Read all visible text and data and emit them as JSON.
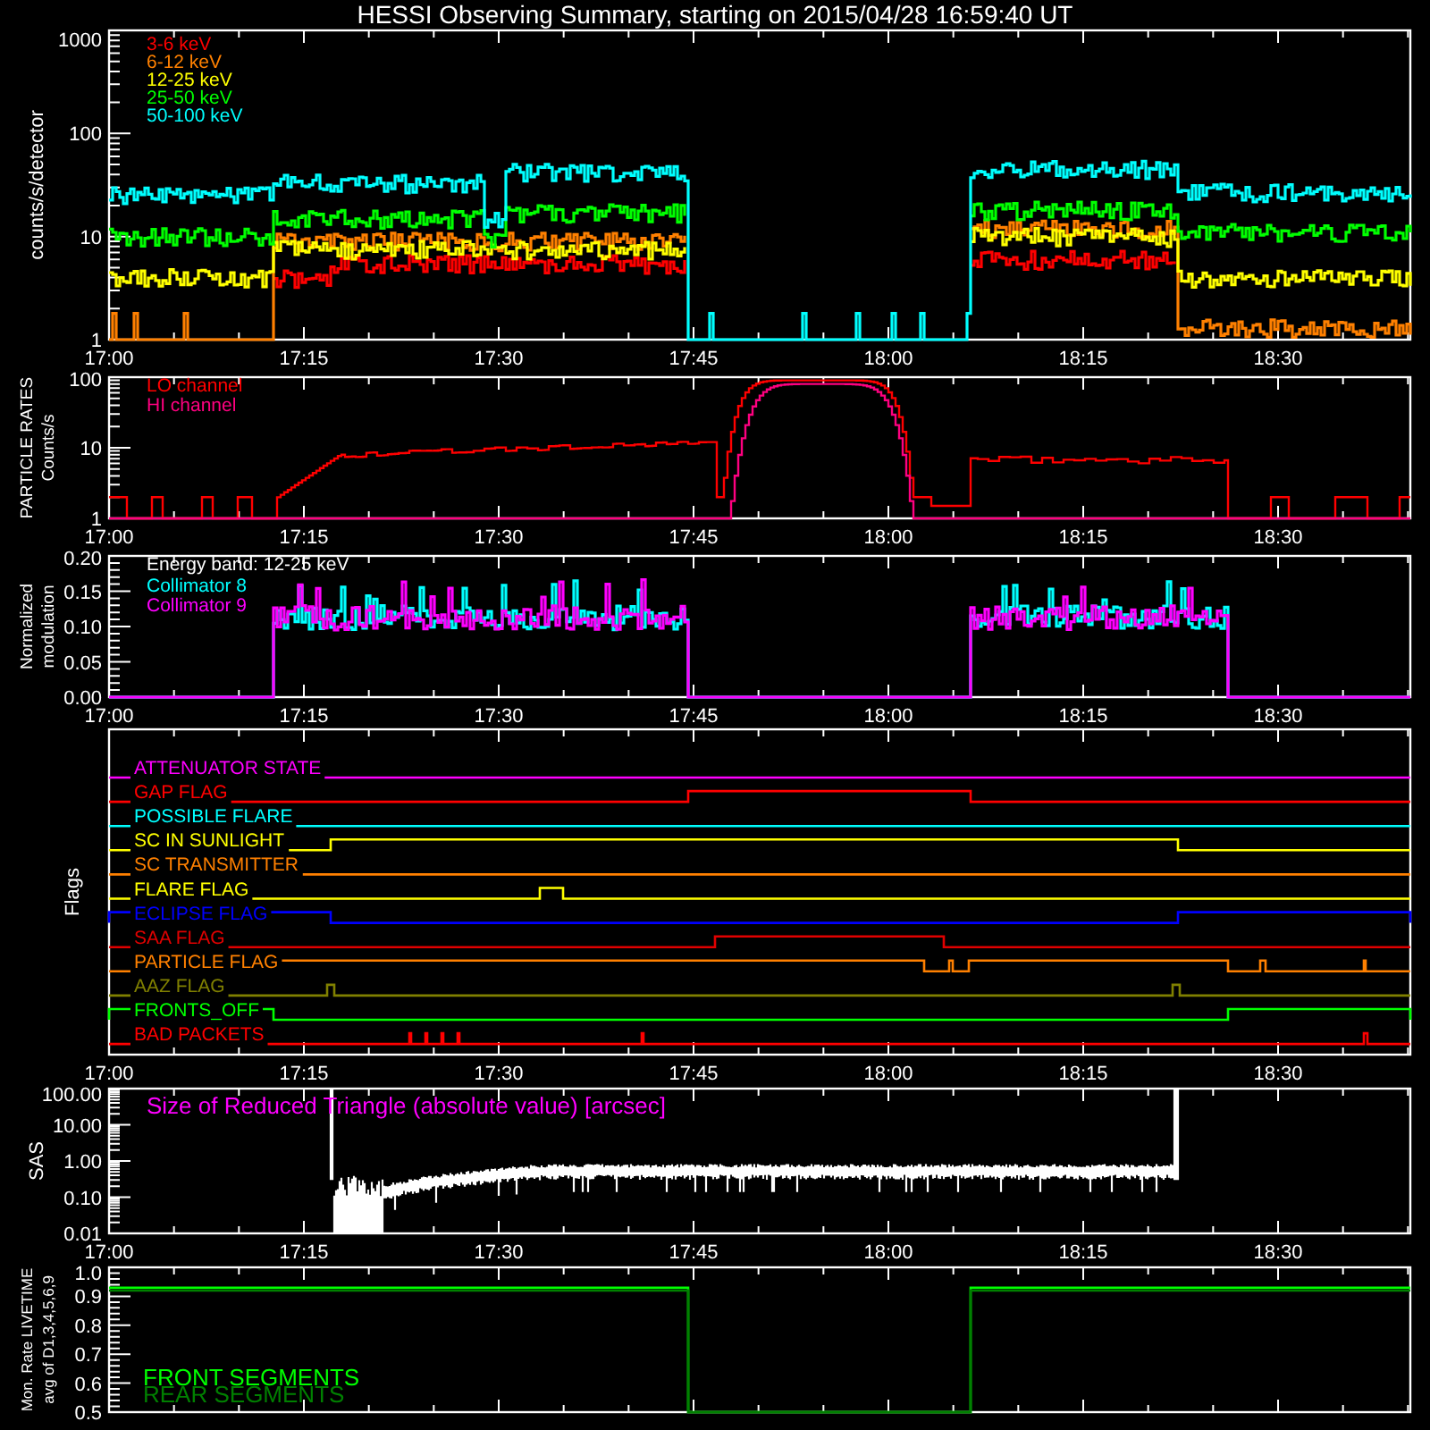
{
  "title": "HESSI Observing Summary, starting on 2015/04/28 16:59:40 UT",
  "panels": [
    {
      "kind": "counts",
      "ylabel": [
        "counts/s/detector"
      ],
      "yticks": [
        "1000",
        "100",
        "10",
        "1"
      ],
      "xticks": [
        "17:00",
        "17:15",
        "17:30",
        "17:45",
        "18:00",
        "18:15",
        "18:30"
      ],
      "legend": [
        {
          "label": "3-6 keV",
          "color": "#ff0000"
        },
        {
          "label": "6-12 keV",
          "color": "#ff8000"
        },
        {
          "label": "12-25 keV",
          "color": "#ffff00"
        },
        {
          "label": "25-50 keV",
          "color": "#00ff00"
        },
        {
          "label": "50-100 keV",
          "color": "#00ffff"
        }
      ]
    },
    {
      "kind": "particles",
      "ylabel": [
        "PARTICLE RATES",
        "Counts/s"
      ],
      "yticks": [
        "100",
        "10",
        "1"
      ],
      "xticks": [
        "17:00",
        "17:15",
        "17:30",
        "17:45",
        "18:00",
        "18:15",
        "18:30"
      ],
      "legend": [
        {
          "label": "LO channel",
          "color": "#ff0000"
        },
        {
          "label": "HI channel",
          "color": "#ff0080"
        }
      ]
    },
    {
      "kind": "modulation",
      "ylabel": [
        "Normalized",
        "modulation"
      ],
      "yticks": [
        "0.20",
        "0.15",
        "0.10",
        "0.05",
        "0.00"
      ],
      "xticks": [
        "17:00",
        "17:15",
        "17:30",
        "17:45",
        "18:00",
        "18:15",
        "18:30"
      ],
      "note": "Energy band: 12-25 keV",
      "legend": [
        {
          "label": "Collimator 8",
          "color": "#00ffff"
        },
        {
          "label": "Collimator 9",
          "color": "#ff00ff"
        }
      ]
    },
    {
      "kind": "flags",
      "ylabel": [
        "Flags"
      ],
      "xticks": [
        "17:00",
        "17:15",
        "17:30",
        "17:45",
        "18:00",
        "18:15",
        "18:30"
      ],
      "flags": [
        {
          "label": "ATTENUATOR STATE",
          "color": "#ff00ff"
        },
        {
          "label": "GAP FLAG",
          "color": "#ff0000"
        },
        {
          "label": "POSSIBLE FLARE",
          "color": "#00ffff"
        },
        {
          "label": "SC IN SUNLIGHT",
          "color": "#ffff00"
        },
        {
          "label": "SC TRANSMITTER",
          "color": "#ff8000"
        },
        {
          "label": "FLARE FLAG",
          "color": "#ffff00"
        },
        {
          "label": "ECLIPSE FLAG",
          "color": "#0000ff"
        },
        {
          "label": "SAA FLAG",
          "color": "#e00000"
        },
        {
          "label": "PARTICLE FLAG",
          "color": "#ff8000"
        },
        {
          "label": "AAZ FLAG",
          "color": "#808000"
        },
        {
          "label": "FRONTS_OFF",
          "color": "#00ff00"
        },
        {
          "label": "BAD PACKETS",
          "color": "#ff0000"
        }
      ]
    },
    {
      "kind": "sas",
      "ylabel": [
        "SAS"
      ],
      "yticks": [
        "100.00",
        "10.00",
        "1.00",
        "0.10",
        "0.01"
      ],
      "xticks": [
        "17:00",
        "17:15",
        "17:30",
        "17:45",
        "18:00",
        "18:15",
        "18:30"
      ],
      "plot_title": "Size of Reduced Triangle (absolute value) [arcsec]"
    },
    {
      "kind": "livetime",
      "ylabel": [
        "Mon. Rate LIVETIME",
        "avg of D1,3,4,5,6,9"
      ],
      "yticks": [
        "1.0",
        "0.9",
        "0.8",
        "0.7",
        "0.6",
        "0.5"
      ],
      "legend": [
        {
          "label": "FRONT SEGMENTS",
          "color": "#00ff00"
        },
        {
          "label": "REAR SEGMENTS",
          "color": "#008000"
        }
      ]
    }
  ]
}
